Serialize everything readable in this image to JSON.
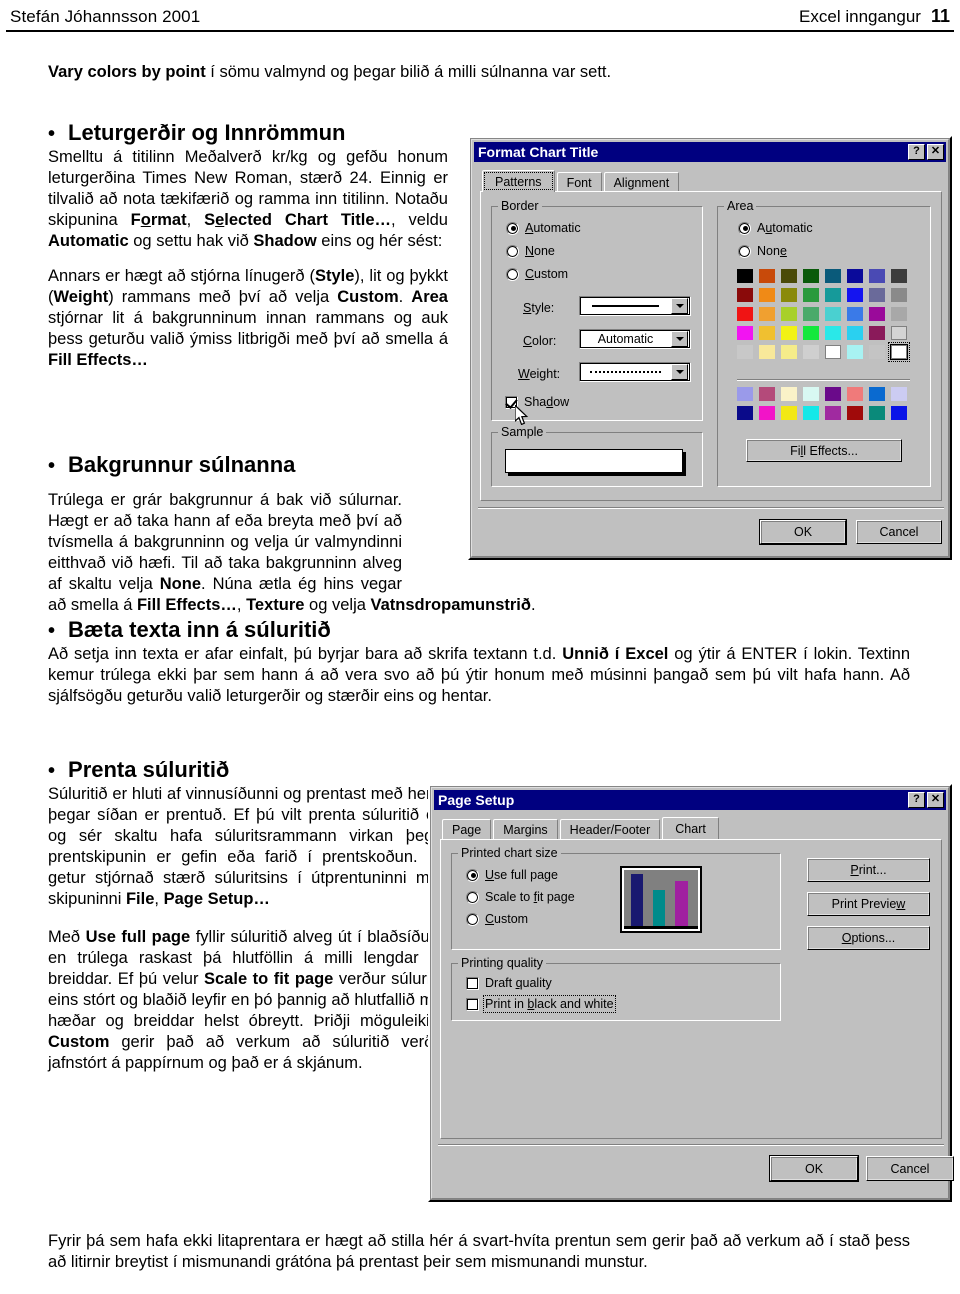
{
  "header": {
    "left": "Stefán Jóhannsson 2001",
    "right": "Excel inngangur",
    "page_number": "11"
  },
  "content": {
    "intro_bold": "Vary colors by point",
    "intro_rest": " í sömu valmynd og þegar bilið á milli súlnanna var sett.",
    "s1_title": "Leturgerðir og Innrömmun",
    "s1_p1_a": "Smelltu á titilinn Meðalverð kr/kg og gefðu honum leturgerðina Times New Roman, stærð 24. Einnig er tilvalið að nota tækifærið og ramma inn titilinn. Notaðu skipunina ",
    "s1_p1_b": "Format",
    "s1_p1_c": ", ",
    "s1_p1_d": "Selected Chart Title…",
    "s1_p1_e": ", veldu ",
    "s1_p1_f": "Automatic",
    "s1_p1_g": " og settu hak við ",
    "s1_p1_h": "Shadow",
    "s1_p1_i": " eins og hér sést:",
    "s1_p2_a": "Annars er hægt að stjórna línugerð (",
    "s1_p2_b": "Style",
    "s1_p2_c": "), lit og þykkt (",
    "s1_p2_d": "Weight",
    "s1_p2_e": ") rammans með því að velja ",
    "s1_p2_f": "Custom",
    "s1_p2_g": ".  ",
    "s1_p2_h": "Area",
    "s1_p2_i": " stjórnar lit á bakgrunninum innan rammans og auk þess geturðu valið ýmiss litbrigði með því að smella á ",
    "s1_p2_j": "Fill Effects…",
    "s2_title": "Bakgrunnur súlnanna",
    "s2_p1_a": "Trúlega er grár bakgrunnur á bak við súlurnar. Hægt er að taka hann af eða breyta með því að tvísmella á bakgrunninn og velja úr valmyndinni eitthvað við hæfi. Til að taka bakgrunninn alveg af skaltu velja ",
    "s2_p1_b": "None",
    "s2_p1_c": ". Núna ætla ég hins vegar að smella á ",
    "s2_p1_d": "Fill Effects…",
    "s2_p1_e": ", ",
    "s2_p1_f": "Texture",
    "s2_p1_g": " og velja ",
    "s2_p1_h": "Vatnsdropamunstrið",
    "s2_p1_i": ".",
    "s3_title": "Bæta texta inn á súluritið",
    "s3_p1_a": "Að setja inn texta er afar einfalt, þú byrjar bara að skrifa textann t.d. ",
    "s3_p1_b": "Unnið í Excel",
    "s3_p1_c": " og ýtir á ENTER í lokin. Textinn kemur trúlega ekki þar sem hann á að vera svo að þú ýtir honum með músinni þangað sem þú vilt hafa hann. Að sjálfsögðu geturðu valið leturgerðir og stærðir eins og hentar.",
    "s4_title": "Prenta súluritið",
    "s4_p1_a": "Súluritið er hluti af vinnusíðunni og prentast með henni þegar síðan er prentuð. Ef þú vilt prenta súluritið eitt og sér skaltu hafa súluritsrammann virkan þegar prentskipunin er gefin eða farið í prentskoðun.  Þú getur stjórnað stærð súluritsins í útprentuninni með skipuninni ",
    "s4_p1_b": "File",
    "s4_p1_c": ", ",
    "s4_p1_d": "Page Setup…",
    "s4_p2_a": "Með ",
    "s4_p2_b": "Use full page",
    "s4_p2_c": " fyllir súluritið alveg út í blaðsíðuna en trúlega raskast þá hlutföllin á milli lengdar og breiddar. Ef þú velur ",
    "s4_p2_d": "Scale to fit page",
    "s4_p2_e": " verður súluritið eins stórt og blaðið leyfir en þó þannig að hlutfallið milli hæðar og breiddar helst óbreytt. Þriðji möguleikinn ",
    "s4_p2_f": "Custom",
    "s4_p2_g": " gerir það að verkum að súluritið verður jafnstórt á pappírnum og það er á skjánum.",
    "closing": "Fyrir þá sem hafa ekki litaprentara er hægt að stilla hér á svart-hvíta prentun sem gerir það að verkum að í stað þess að litirnir breytist í mismunandi grátóna þá prentast þeir sem mismunandi munstur."
  },
  "format_chart_title_dialog": {
    "title": "Format Chart Title",
    "help_button": "?",
    "close_button": "✕",
    "tabs": [
      {
        "label": "Patterns",
        "selected": true
      },
      {
        "label": "Font",
        "selected": false
      },
      {
        "label": "Alignment",
        "selected": false
      }
    ],
    "border_group": {
      "label": "Border",
      "options": [
        {
          "label": "Automatic",
          "selected": true
        },
        {
          "label": "None",
          "selected": false
        },
        {
          "label": "Custom",
          "selected": false
        }
      ],
      "style_label": "Style:",
      "style_value": "",
      "color_label": "Color:",
      "color_value": "Automatic",
      "weight_label": "Weight:",
      "weight_value": "",
      "shadow_label": "Shadow",
      "shadow_checked": true
    },
    "sample_group": {
      "label": "Sample"
    },
    "area_group": {
      "label": "Area",
      "options": [
        {
          "label": "Automatic",
          "selected": true
        },
        {
          "label": "None",
          "selected": false
        }
      ],
      "fill_effects_button": "Fill Effects...",
      "palette_rows": [
        [
          "#000000",
          "#c84a0a",
          "#4a4a08",
          "#0a5a0a",
          "#0a5a7a",
          "#0a0a9a",
          "#4a4ab4",
          "#3c3c3c"
        ],
        [
          "#8a0a0a",
          "#f08a16",
          "#8a8a0a",
          "#2a9a3c",
          "#169a9a",
          "#1414f0",
          "#6a6a9a",
          "#8a8a8a"
        ],
        [
          "#f01414",
          "#f0a030",
          "#a8d02a",
          "#4aaa6a",
          "#4ad0d0",
          "#3a7ae8",
          "#9a0a9a",
          "#a8a8a8"
        ],
        [
          "#f214f2",
          "#f0c030",
          "#f2f214",
          "#14e83c",
          "#2ae8e8",
          "#2ad0f0",
          "#8a1a5a",
          "#d4d4d4"
        ],
        [
          "#c8c8c8",
          "#f8e89a",
          "#f5ec8a",
          "#cfcfcf",
          "#ffffff",
          "#a8f2f2",
          "#c4c4c4",
          "#ffffff"
        ]
      ],
      "palette_rows2": [
        [
          "#9a9aea",
          "#b44a7a",
          "#faf2c8",
          "#d8f8f2",
          "#6a0a8a",
          "#f07a7a",
          "#0a6ad0",
          "#ccccf2"
        ],
        [
          "#0a0a8a",
          "#f214c8",
          "#f2e814",
          "#14e8e8",
          "#a02aa0",
          "#a00a0a",
          "#0a8a7a",
          "#0a14e8"
        ]
      ],
      "selected_swatch": {
        "row": 4,
        "col": 7
      }
    },
    "ok_button": "OK",
    "cancel_button": "Cancel"
  },
  "page_setup_dialog": {
    "title": "Page Setup",
    "help_button": "?",
    "close_button": "✕",
    "tabs": [
      {
        "label": "Page",
        "selected": false
      },
      {
        "label": "Margins",
        "selected": false
      },
      {
        "label": "Header/Footer",
        "selected": false
      },
      {
        "label": "Chart",
        "selected": true
      }
    ],
    "printed_chart_size": {
      "label": "Printed chart size",
      "options": [
        {
          "label": "Use full page",
          "selected": true
        },
        {
          "label": "Scale to fit page",
          "selected": false
        },
        {
          "label": "Custom",
          "selected": false
        }
      ],
      "preview_bars": [
        {
          "color": "#191970",
          "height_pct": 92
        },
        {
          "color": "#008b8b",
          "height_pct": 64
        },
        {
          "color": "#a020a0",
          "height_pct": 80
        }
      ],
      "preview_bg": "#808080"
    },
    "printing_quality": {
      "label": "Printing quality",
      "options": [
        {
          "label": "Draft quality",
          "checked": false,
          "focused": false
        },
        {
          "label": "Print in black and white",
          "checked": false,
          "focused": true
        }
      ]
    },
    "side_buttons": [
      "Print...",
      "Print Preview",
      "Options..."
    ],
    "ok_button": "OK",
    "cancel_button": "Cancel"
  }
}
